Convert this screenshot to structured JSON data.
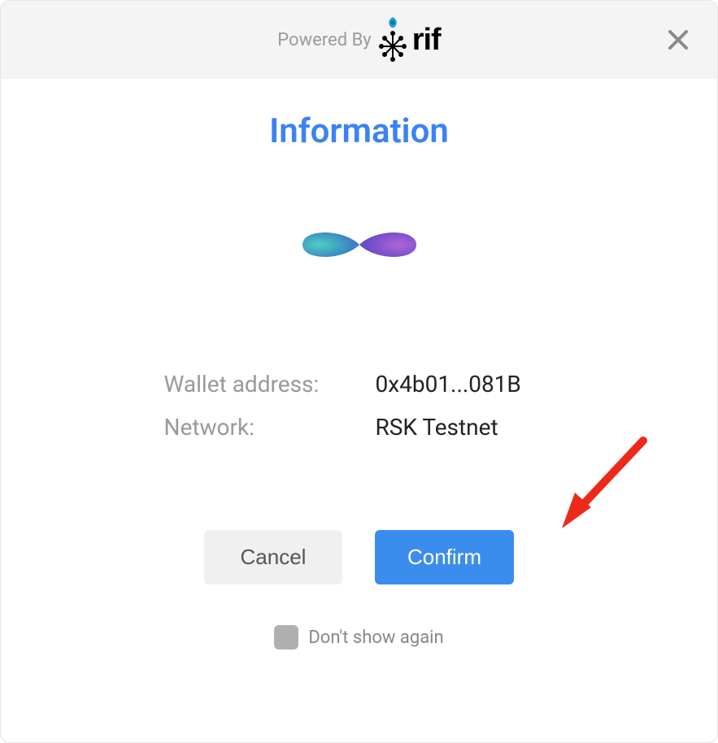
{
  "header": {
    "powered_by": "Powered By",
    "brand_text": "rif"
  },
  "modal": {
    "title": "Information",
    "fields": [
      {
        "label": "Wallet address:",
        "value": "0x4b01...081B"
      },
      {
        "label": "Network:",
        "value": "RSK Testnet"
      }
    ],
    "buttons": {
      "cancel": "Cancel",
      "confirm": "Confirm"
    },
    "dont_show": "Don't show again"
  }
}
